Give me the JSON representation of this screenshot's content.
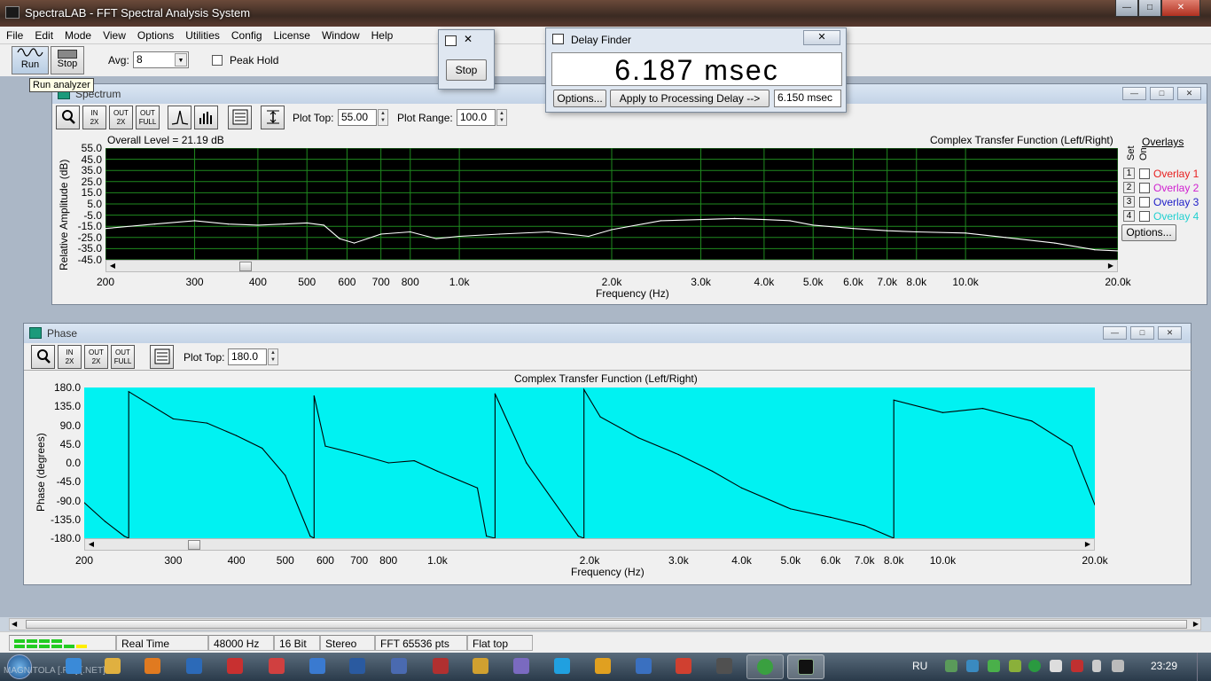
{
  "window": {
    "title": "SpectraLAB - FFT Spectral Analysis System"
  },
  "menu": [
    "File",
    "Edit",
    "Mode",
    "View",
    "Options",
    "Utilities",
    "Config",
    "License",
    "Window",
    "Help"
  ],
  "toolbar": {
    "run_label": "Run",
    "stop_label": "Stop",
    "avg_label": "Avg:",
    "avg_value": "8",
    "peak_hold_label": "Peak Hold",
    "tooltip": "Run analyzer"
  },
  "stop_dialog": {
    "stop_label": "Stop"
  },
  "delay_finder": {
    "title": "Delay Finder",
    "readout": "6.187 msec",
    "options_label": "Options...",
    "apply_label": "Apply to Processing Delay -->",
    "applied_value": "6.150 msec"
  },
  "spectrum": {
    "title": "Spectrum",
    "plot_top_label": "Plot Top:",
    "plot_top_value": "55.00",
    "plot_range_label": "Plot Range:",
    "plot_range_value": "100.0",
    "overall_level": "Overall Level = 21.19 dB",
    "chart_title": "Complex Transfer Function (Left/Right)",
    "overlays_label": "Overlays",
    "set_label": "Set",
    "on_label": "On",
    "overlays": [
      {
        "num": "1",
        "name": "Overlay 1",
        "color": "#e82020"
      },
      {
        "num": "2",
        "name": "Overlay 2",
        "color": "#d020d0"
      },
      {
        "num": "3",
        "name": "Overlay 3",
        "color": "#2020c8"
      },
      {
        "num": "4",
        "name": "Overlay 4",
        "color": "#20d0d0"
      }
    ],
    "options_label": "Options..."
  },
  "phase": {
    "title": "Phase",
    "plot_top_label": "Plot Top:",
    "plot_top_value": "180.0",
    "chart_title": "Complex Transfer Function (Left/Right)"
  },
  "status": {
    "mode": "Real Time",
    "rate": "48000 Hz",
    "bits": "16 Bit",
    "channels": "Stereo",
    "fft": "FFT 65536 pts",
    "window": "Flat top"
  },
  "taskbar": {
    "language": "RU",
    "time": "23:29",
    "tray_text": "MAGNITOLA [.RU] [.NET]"
  },
  "colors": {
    "spectrum_bg": "#000000",
    "spectrum_grid": "#1f8a1f",
    "spectrum_line": "#ffffff",
    "phase_bg": "#00f2f2",
    "phase_line": "#000000"
  },
  "chart_data": [
    {
      "type": "line",
      "title": "Complex Transfer Function (Left/Right)",
      "xlabel": "Frequency (Hz)",
      "ylabel": "Relative Amplitude (dB)",
      "x_scale": "log",
      "xlim": [
        200,
        20000
      ],
      "ylim": [
        -45,
        55
      ],
      "grid": true,
      "y_ticks": [
        "55.0",
        "45.0",
        "35.0",
        "25.0",
        "15.0",
        "5.0",
        "-5.0",
        "-15.0",
        "-25.0",
        "-35.0",
        "-45.0"
      ],
      "x_ticks": [
        {
          "v": 200,
          "l": "200"
        },
        {
          "v": 300,
          "l": "300"
        },
        {
          "v": 400,
          "l": "400"
        },
        {
          "v": 500,
          "l": "500"
        },
        {
          "v": 600,
          "l": "600"
        },
        {
          "v": 700,
          "l": "700"
        },
        {
          "v": 800,
          "l": "800"
        },
        {
          "v": 1000,
          "l": "1.0k"
        },
        {
          "v": 2000,
          "l": "2.0k"
        },
        {
          "v": 3000,
          "l": "3.0k"
        },
        {
          "v": 4000,
          "l": "4.0k"
        },
        {
          "v": 5000,
          "l": "5.0k"
        },
        {
          "v": 6000,
          "l": "6.0k"
        },
        {
          "v": 7000,
          "l": "7.0k"
        },
        {
          "v": 8000,
          "l": "8.0k"
        },
        {
          "v": 10000,
          "l": "10.0k"
        },
        {
          "v": 20000,
          "l": "20.0k"
        }
      ],
      "x": [
        200,
        250,
        300,
        350,
        400,
        450,
        500,
        540,
        580,
        620,
        700,
        800,
        900,
        1000,
        1200,
        1500,
        1800,
        2000,
        2500,
        3000,
        3500,
        4000,
        4500,
        5000,
        6000,
        7000,
        8000,
        10000,
        12000,
        15000,
        18000,
        20000
      ],
      "y": [
        -17,
        -13,
        -10,
        -13,
        -14,
        -13,
        -12,
        -14,
        -26,
        -30,
        -22,
        -20,
        -26,
        -24,
        -22,
        -20,
        -24,
        -18,
        -10,
        -9,
        -8,
        -9,
        -10,
        -14,
        -17,
        -19,
        -20,
        -21,
        -25,
        -30,
        -36,
        -37
      ]
    },
    {
      "type": "line",
      "title": "Complex Transfer Function (Left/Right)",
      "xlabel": "Frequency (Hz)",
      "ylabel": "Phase (degrees)",
      "x_scale": "log",
      "xlim": [
        200,
        20000
      ],
      "ylim": [
        -180,
        180
      ],
      "grid": false,
      "y_ticks": [
        "180.0",
        "135.0",
        "90.0",
        "45.0",
        "0.0",
        "-45.0",
        "-90.0",
        "-135.0",
        "-180.0"
      ],
      "x_ticks": [
        {
          "v": 200,
          "l": "200"
        },
        {
          "v": 300,
          "l": "300"
        },
        {
          "v": 400,
          "l": "400"
        },
        {
          "v": 500,
          "l": "500"
        },
        {
          "v": 600,
          "l": "600"
        },
        {
          "v": 700,
          "l": "700"
        },
        {
          "v": 800,
          "l": "800"
        },
        {
          "v": 1000,
          "l": "1.0k"
        },
        {
          "v": 2000,
          "l": "2.0k"
        },
        {
          "v": 3000,
          "l": "3.0k"
        },
        {
          "v": 4000,
          "l": "4.0k"
        },
        {
          "v": 5000,
          "l": "5.0k"
        },
        {
          "v": 6000,
          "l": "6.0k"
        },
        {
          "v": 7000,
          "l": "7.0k"
        },
        {
          "v": 8000,
          "l": "8.0k"
        },
        {
          "v": 10000,
          "l": "10.0k"
        },
        {
          "v": 20000,
          "l": "20.0k"
        }
      ],
      "x": [
        200,
        220,
        240,
        245,
        300,
        350,
        400,
        450,
        500,
        560,
        570,
        600,
        700,
        800,
        900,
        1000,
        1200,
        1250,
        1300,
        1500,
        1900,
        1950,
        2100,
        2500,
        3000,
        3500,
        4000,
        5000,
        6000,
        7000,
        8000,
        10000,
        12000,
        15000,
        18000,
        20000
      ],
      "y": [
        -95,
        -140,
        -175,
        170,
        105,
        95,
        65,
        35,
        -30,
        -175,
        160,
        40,
        20,
        0,
        5,
        -20,
        -60,
        -175,
        165,
        0,
        -175,
        175,
        110,
        60,
        20,
        -20,
        -60,
        -110,
        -130,
        -150,
        150,
        120,
        130,
        100,
        40,
        -100
      ]
    }
  ]
}
